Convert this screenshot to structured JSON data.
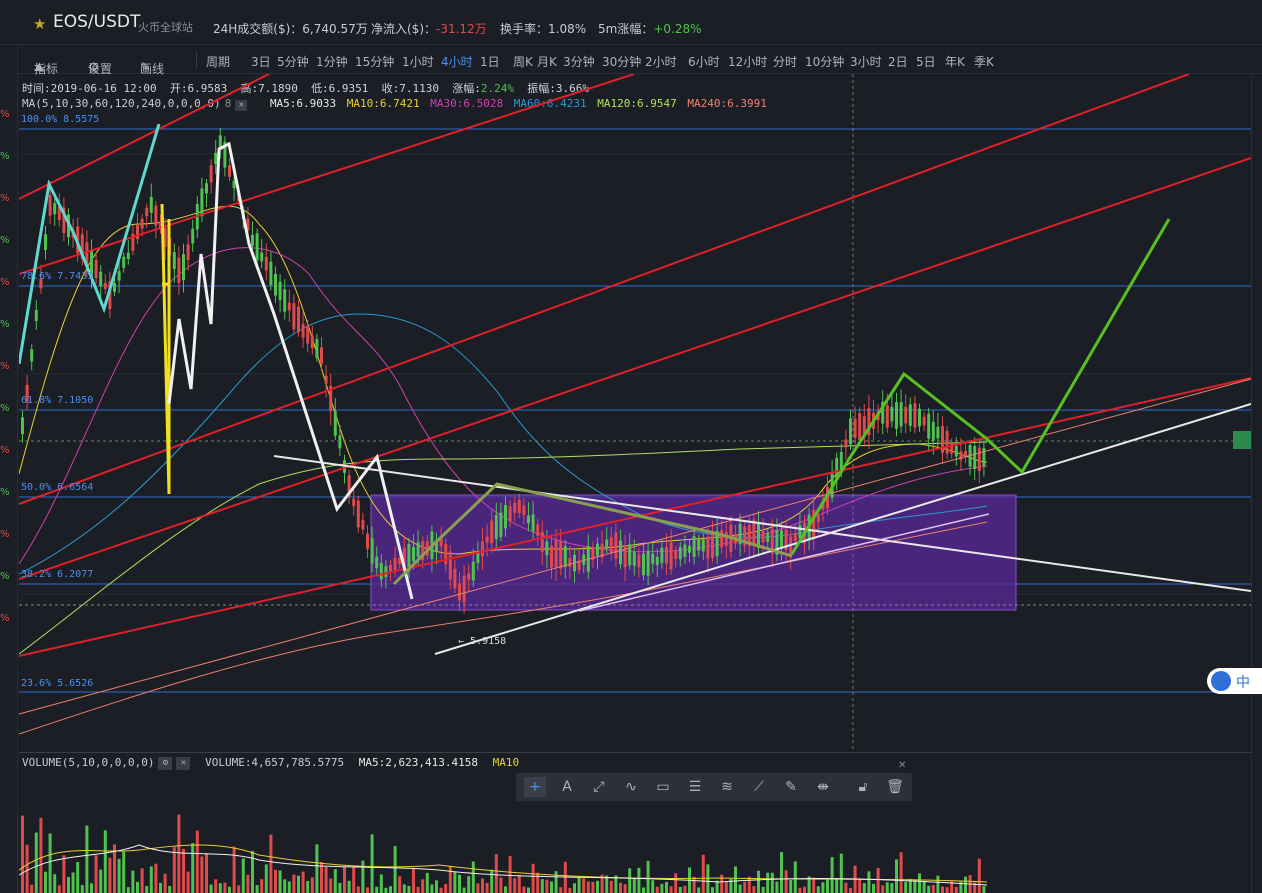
{
  "header": {
    "pair": "EOS/USDT",
    "exchange": "火币全球站",
    "volume_label": "24H成交额($)：",
    "volume_value": "6,740.57万",
    "inflow_label": "净流入($)：",
    "inflow_value": "-31.12万",
    "turnover_label": "换手率：",
    "turnover_value": "1.08%",
    "change5m_label": "5m涨幅：",
    "change5m_value": "+0.28%"
  },
  "toolbar": {
    "indicator": "指标",
    "settings": "设置",
    "draw": "画线",
    "period": "周期",
    "periods": [
      "3日",
      "5分钟",
      "1分钟",
      "15分钟",
      "1小时",
      "4小时",
      "1日",
      "周K",
      "月K",
      "3分钟",
      "30分钟",
      "2小时",
      "6小时",
      "12小时",
      "分时",
      "10分钟",
      "3小时",
      "2日",
      "5日",
      "年K",
      "季K"
    ],
    "active_period": "4小时"
  },
  "info": {
    "time": "时间:2019-06-16 12:00",
    "open": "开:6.9583",
    "high": "高:7.1890",
    "low": "低:6.9351",
    "close": "收:7.1130",
    "change_label": "涨幅:",
    "change_value": "2.24%",
    "amp_label": "振幅:",
    "amp_value": "3.66%"
  },
  "ma_line": {
    "title": "MA(5,10,30,60,120,240,0,0,0,0)",
    "ma5": "MA5:6.9033",
    "ma10": "MA10:6.7421",
    "ma30": "MA30:6.5028",
    "ma60": "MA60:6.4231",
    "ma120": "MA120:6.9547",
    "ma240": "MA240:6.3991"
  },
  "fib": [
    {
      "label": "100.0% 8.5575"
    },
    {
      "label": "78.6% 7.7433"
    },
    {
      "label": "61.8% 7.1050"
    },
    {
      "label": "50.0% 6.6564"
    },
    {
      "label": "38.2% 6.2077"
    },
    {
      "label": "23.6% 5.6526"
    }
  ],
  "low_marker": "← 5.9158",
  "volume": {
    "title": "VOLUME(5,10,0,0,0,0)",
    "value": "VOLUME:4,657,785.5775",
    "ma5": "MA5:2,623,413.4158",
    "ma10": "MA10"
  },
  "left_axis_ticks": [
    "%",
    "%",
    "%",
    "%",
    "%",
    "%",
    "%",
    "%",
    "%",
    "%",
    "%",
    "%",
    "%"
  ],
  "lang_badge": "中",
  "colors": {
    "up": "#4fc24f",
    "down": "#e04a4a",
    "accent": "#4a90f0",
    "ma10": "#e8d030",
    "ma30": "#d040b0",
    "ma60": "#2a9ad0",
    "ma120": "#b0e060",
    "ma240": "#f08070",
    "box": "#5a2a9a"
  }
}
